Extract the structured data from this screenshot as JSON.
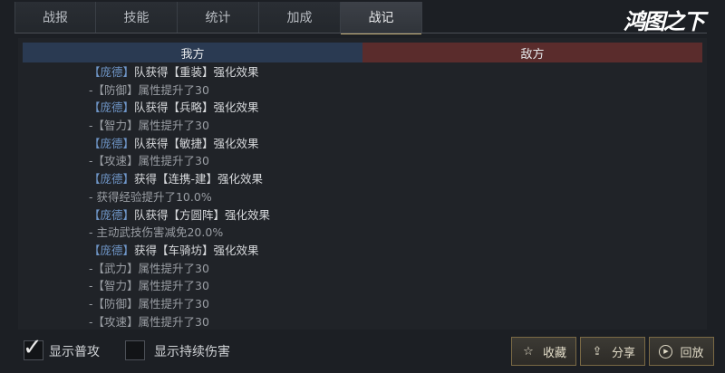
{
  "tabs": [
    "战报",
    "技能",
    "统计",
    "加成",
    "战记"
  ],
  "active_tab_index": 4,
  "logo_text": "鸿图之下",
  "header": {
    "ours": "我方",
    "enemy": "敌方"
  },
  "log": [
    {
      "kind": "main",
      "name": "【庞德】",
      "text": "队获得【重装】强化效果"
    },
    {
      "kind": "sub",
      "text": "-【防御】属性提升了30"
    },
    {
      "kind": "main",
      "name": "【庞德】",
      "text": "队获得【兵略】强化效果"
    },
    {
      "kind": "sub",
      "text": "-【智力】属性提升了30"
    },
    {
      "kind": "main",
      "name": "【庞德】",
      "text": "队获得【敏捷】强化效果"
    },
    {
      "kind": "sub",
      "text": "-【攻速】属性提升了30"
    },
    {
      "kind": "main",
      "name": "【庞德】",
      "text": "获得【连携-建】强化效果"
    },
    {
      "kind": "sub",
      "text": "- 获得经验提升了10.0%"
    },
    {
      "kind": "main",
      "name": "【庞德】",
      "text": "队获得【方圆阵】强化效果"
    },
    {
      "kind": "sub",
      "text": "- 主动武技伤害减免20.0%"
    },
    {
      "kind": "main",
      "name": "【庞德】",
      "text": "获得【车骑坊】强化效果"
    },
    {
      "kind": "sub",
      "text": "-【武力】属性提升了30"
    },
    {
      "kind": "sub",
      "text": "-【智力】属性提升了30"
    },
    {
      "kind": "sub",
      "text": "-【防御】属性提升了30"
    },
    {
      "kind": "sub",
      "text": "-【攻速】属性提升了30"
    }
  ],
  "footer": {
    "show_normal_attack": {
      "label": "显示普攻",
      "checked": true
    },
    "show_dot": {
      "label": "显示持续伤害",
      "checked": false
    },
    "buttons": {
      "collect": "收藏",
      "share": "分享",
      "replay": "回放"
    }
  },
  "colors": {
    "accent": "#c7b27a",
    "ally_header": "#2a3a52",
    "enemy_header": "#5a2c2c",
    "name_blue": "#6f96c8"
  }
}
